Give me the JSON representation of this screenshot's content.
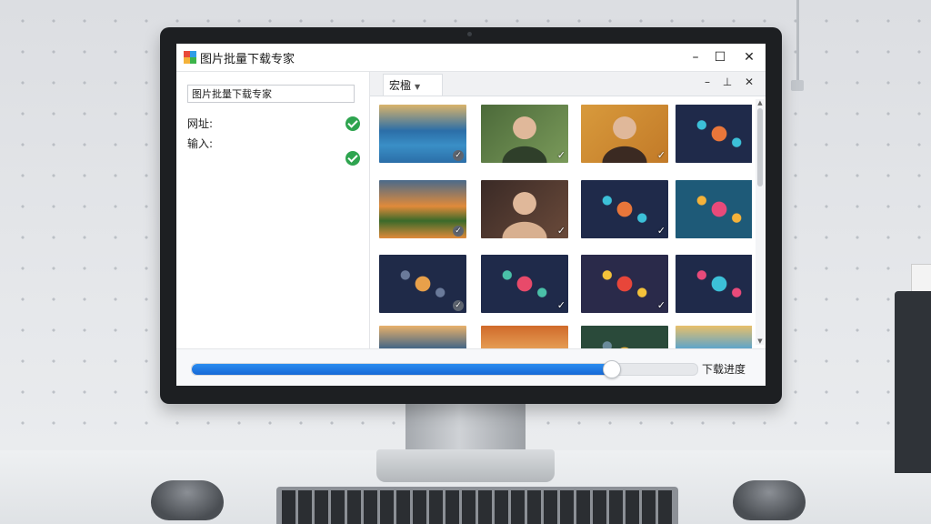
{
  "app": {
    "title": "图片批量下载专家",
    "window_controls": [
      "minimize",
      "maximize",
      "close"
    ]
  },
  "left_panel": {
    "name_field_value": "图片批量下载专家",
    "url_label": "网址:",
    "input_label": "输入:",
    "url_status_icon": "check-circle-icon",
    "input_status_icon": "check-circle-icon"
  },
  "right_panel": {
    "tab_label": "宏楹",
    "thumbnails": [
      {
        "subject": "mountain-lake",
        "colors": [
          "#2b6ea8",
          "#d9b36a",
          "#3a8fc6"
        ]
      },
      {
        "subject": "man-portrait",
        "colors": [
          "#4c6a3a",
          "#7a9a5a",
          "#2f3f2a"
        ]
      },
      {
        "subject": "woman-portrait",
        "colors": [
          "#d89a3c",
          "#c27a28",
          "#3b2a22"
        ]
      },
      {
        "subject": "network-diagram",
        "colors": [
          "#1f2a4a",
          "#e8763a",
          "#3cc0d8"
        ]
      },
      {
        "subject": "mountain-sunset",
        "colors": [
          "#e08a3a",
          "#4a6a8a",
          "#3a6a2a"
        ]
      },
      {
        "subject": "woman-portrait",
        "colors": [
          "#3a2a26",
          "#6a4a3a",
          "#d8b090"
        ]
      },
      {
        "subject": "network-diagram",
        "colors": [
          "#1f2a4a",
          "#e8763a",
          "#3cc0d8"
        ]
      },
      {
        "subject": "colorful-layers",
        "colors": [
          "#1e5a78",
          "#e84a7a",
          "#f4b23a"
        ]
      },
      {
        "subject": "city-road",
        "colors": [
          "#1f2a48",
          "#e8a04a",
          "#6a7a9a"
        ]
      },
      {
        "subject": "abstract-shapes",
        "colors": [
          "#1f2a4a",
          "#e84a6a",
          "#4ac0a8"
        ]
      },
      {
        "subject": "abstract-shapes",
        "colors": [
          "#2a2a4a",
          "#e8463a",
          "#f4c23a"
        ]
      },
      {
        "subject": "colorful-layers",
        "colors": [
          "#1f2a4a",
          "#3cc0d8",
          "#e84a7a"
        ]
      },
      {
        "subject": "mountain-sky",
        "colors": [
          "#2a5a8a",
          "#e8b06a",
          "#3a4a5a"
        ]
      },
      {
        "subject": "desert-sunrise",
        "colors": [
          "#e8a45a",
          "#d06a2a",
          "#3a5a7a"
        ]
      },
      {
        "subject": "gears",
        "colors": [
          "#2a4a3a",
          "#e8b03a",
          "#6a8a9a"
        ]
      },
      {
        "subject": "mountain-sky",
        "colors": [
          "#4aa0d8",
          "#e8c06a",
          "#2a6a9a"
        ]
      }
    ]
  },
  "progress": {
    "value": 0.83,
    "label": "下载进度"
  },
  "colors": {
    "accent": "#1f78e6",
    "success": "#2ea44f",
    "bezel": "#1d1f22"
  }
}
